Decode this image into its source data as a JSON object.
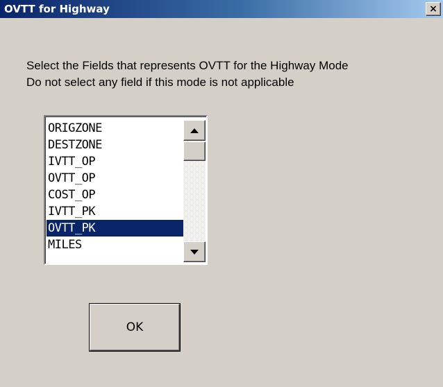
{
  "window": {
    "title": "OVTT for Highway",
    "close_glyph": "×",
    "close_icon": "close-icon"
  },
  "prompt": {
    "line1": "Select the Fields that represents OVTT for the Highway Mode",
    "line2": "Do not select any field if this mode is not applicable"
  },
  "fields": {
    "items": [
      "ORIGZONE",
      "DESTZONE",
      "IVTT_OP",
      "OVTT_OP",
      "COST_OP",
      "IVTT_PK",
      "OVTT_PK",
      "MILES"
    ],
    "selected": "OVTT_PK"
  },
  "buttons": {
    "ok_label": "OK"
  },
  "colors": {
    "dialog_bg": "#d4d0c8",
    "title_start": "#0a246a",
    "title_end": "#a6caf0",
    "selection": "#0a246a"
  }
}
